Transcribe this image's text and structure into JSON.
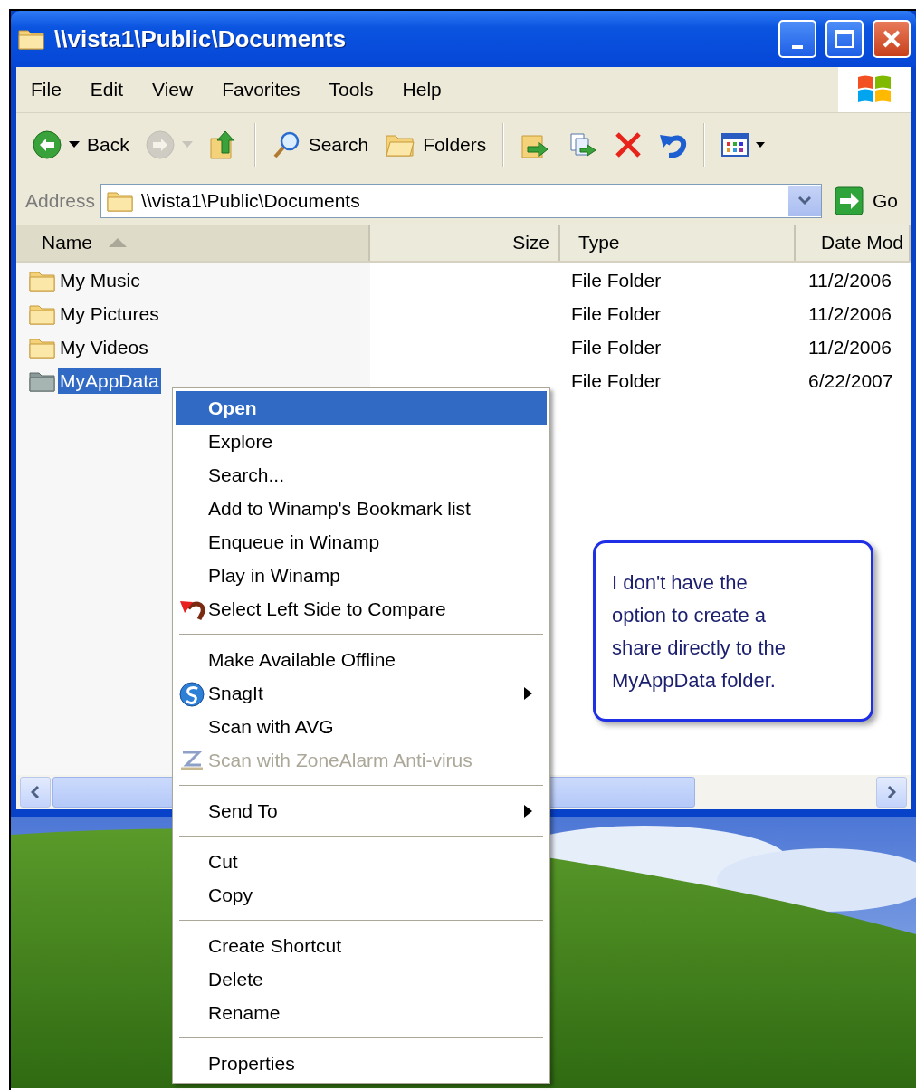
{
  "window": {
    "title": "\\\\vista1\\Public\\Documents"
  },
  "menu_bar": [
    "File",
    "Edit",
    "View",
    "Favorites",
    "Tools",
    "Help"
  ],
  "toolbar": [
    {
      "kind": "back",
      "label": "Back",
      "disabled": false
    },
    {
      "kind": "forward",
      "disabled": true
    },
    {
      "kind": "up",
      "disabled": false
    },
    {
      "kind": "separator"
    },
    {
      "kind": "search",
      "label": "Search",
      "disabled": false
    },
    {
      "kind": "folders",
      "label": "Folders",
      "disabled": false
    },
    {
      "kind": "separator"
    },
    {
      "kind": "move",
      "disabled": false
    },
    {
      "kind": "copy",
      "disabled": false
    },
    {
      "kind": "delete",
      "disabled": false
    },
    {
      "kind": "undo",
      "disabled": false
    },
    {
      "kind": "separator"
    },
    {
      "kind": "views",
      "disabled": false
    }
  ],
  "address_bar": {
    "label": "Address",
    "value": "\\\\vista1\\Public\\Documents",
    "go": "Go"
  },
  "file_list": {
    "columns": [
      {
        "label": "Name",
        "sorted": true
      },
      {
        "label": "Size",
        "sorted": false
      },
      {
        "label": "Type",
        "sorted": false
      },
      {
        "label": "Date Mod",
        "sorted": false
      }
    ],
    "rows": [
      {
        "name": "My Music",
        "type": "File Folder",
        "date": "11/2/2006",
        "selected": false
      },
      {
        "name": "My Pictures",
        "type": "File Folder",
        "date": "11/2/2006",
        "selected": false
      },
      {
        "name": "My Videos",
        "type": "File Folder",
        "date": "11/2/2006",
        "selected": false
      },
      {
        "name": "MyAppData",
        "type": "File Folder",
        "date": "6/22/2007",
        "selected": true
      }
    ]
  },
  "context_menu": [
    {
      "kind": "item",
      "label": "Open",
      "default": true,
      "selected": true,
      "disabled": false,
      "submenu": false
    },
    {
      "kind": "item",
      "label": "Explore",
      "default": false,
      "selected": false,
      "disabled": false,
      "submenu": false
    },
    {
      "kind": "item",
      "label": "Search...",
      "default": false,
      "selected": false,
      "disabled": false,
      "submenu": false
    },
    {
      "kind": "item",
      "label": "Add to Winamp's Bookmark list",
      "default": false,
      "selected": false,
      "disabled": false,
      "submenu": false
    },
    {
      "kind": "item",
      "label": "Enqueue in Winamp",
      "default": false,
      "selected": false,
      "disabled": false,
      "submenu": false
    },
    {
      "kind": "item",
      "label": "Play in Winamp",
      "default": false,
      "selected": false,
      "disabled": false,
      "submenu": false
    },
    {
      "kind": "item",
      "label": "Select Left Side to Compare",
      "default": false,
      "selected": false,
      "disabled": false,
      "submenu": false
    },
    {
      "kind": "separator"
    },
    {
      "kind": "item",
      "label": "Make Available Offline",
      "default": false,
      "selected": false,
      "disabled": false,
      "submenu": false
    },
    {
      "kind": "item",
      "label": "SnagIt",
      "default": false,
      "selected": false,
      "disabled": false,
      "submenu": true
    },
    {
      "kind": "item",
      "label": "Scan with AVG",
      "default": false,
      "selected": false,
      "disabled": false,
      "submenu": false
    },
    {
      "kind": "item",
      "label": "Scan with ZoneAlarm Anti-virus",
      "default": false,
      "selected": false,
      "disabled": true,
      "submenu": false
    },
    {
      "kind": "separator"
    },
    {
      "kind": "item",
      "label": "Send To",
      "default": false,
      "selected": false,
      "disabled": false,
      "submenu": true
    },
    {
      "kind": "separator"
    },
    {
      "kind": "item",
      "label": "Cut",
      "default": false,
      "selected": false,
      "disabled": false,
      "submenu": false
    },
    {
      "kind": "item",
      "label": "Copy",
      "default": false,
      "selected": false,
      "disabled": false,
      "submenu": false
    },
    {
      "kind": "separator"
    },
    {
      "kind": "item",
      "label": "Create Shortcut",
      "default": false,
      "selected": false,
      "disabled": false,
      "submenu": false
    },
    {
      "kind": "item",
      "label": "Delete",
      "default": false,
      "selected": false,
      "disabled": false,
      "submenu": false
    },
    {
      "kind": "item",
      "label": "Rename",
      "default": false,
      "selected": false,
      "disabled": false,
      "submenu": false
    },
    {
      "kind": "separator"
    },
    {
      "kind": "item",
      "label": "Properties",
      "default": false,
      "selected": false,
      "disabled": false,
      "submenu": false
    }
  ],
  "callout": {
    "text": "I don't have the option to create a share directly to the MyAppData folder."
  }
}
